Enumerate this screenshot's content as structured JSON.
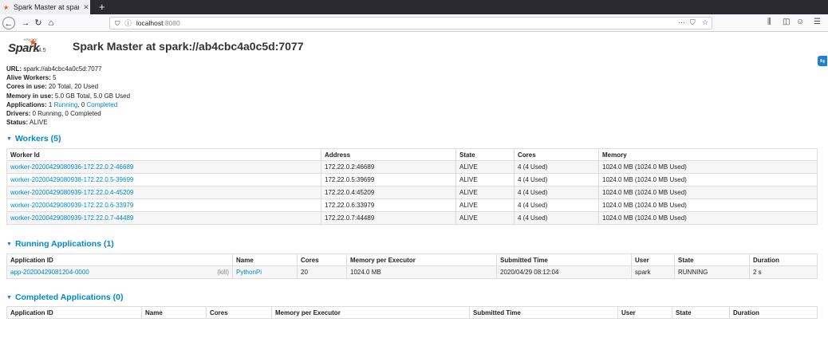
{
  "browser": {
    "tab_title": "Spark Master at spark://",
    "url_host": "localhost",
    "url_port": ":8080"
  },
  "header": {
    "logo_apache": "APACHE",
    "logo_text": "Spark",
    "version": "2.4.5",
    "title": "Spark Master at spark://ab4cbc4a0c5d:7077"
  },
  "summary": {
    "url_label": "URL:",
    "url_value": " spark://ab4cbc4a0c5d:7077",
    "alive_label": "Alive Workers:",
    "alive_value": " 5",
    "cores_label": "Cores in use:",
    "cores_value": " 20 Total, 20 Used",
    "memory_label": "Memory in use:",
    "memory_value": " 5.0 GB Total, 5.0 GB Used",
    "apps_label": "Applications:",
    "apps_running_count": " 1 ",
    "apps_running_link": "Running",
    "apps_sep": ", 0 ",
    "apps_completed_link": "Completed",
    "drivers_label": "Drivers:",
    "drivers_value": " 0 Running, 0 Completed",
    "status_label": "Status:",
    "status_value": " ALIVE"
  },
  "workers": {
    "heading": "Workers (5)",
    "columns": [
      "Worker Id",
      "Address",
      "State",
      "Cores",
      "Memory"
    ],
    "rows": [
      [
        "worker-20200429080936-172.22.0.2-46689",
        "172.22.0.2:46689",
        "ALIVE",
        "4 (4 Used)",
        "1024.0 MB (1024.0 MB Used)"
      ],
      [
        "worker-20200429080938-172.22.0.5-39699",
        "172.22.0.5:39699",
        "ALIVE",
        "4 (4 Used)",
        "1024.0 MB (1024.0 MB Used)"
      ],
      [
        "worker-20200429080939-172.22.0.4-45209",
        "172.22.0.4:45209",
        "ALIVE",
        "4 (4 Used)",
        "1024.0 MB (1024.0 MB Used)"
      ],
      [
        "worker-20200429080939-172.22.0.6-33979",
        "172.22.0.6:33979",
        "ALIVE",
        "4 (4 Used)",
        "1024.0 MB (1024.0 MB Used)"
      ],
      [
        "worker-20200429080939-172.22.0.7-44489",
        "172.22.0.7:44489",
        "ALIVE",
        "4 (4 Used)",
        "1024.0 MB (1024.0 MB Used)"
      ]
    ]
  },
  "running": {
    "heading": "Running Applications (1)",
    "columns": [
      "Application ID",
      "Name",
      "Cores",
      "Memory per Executor",
      "Submitted Time",
      "User",
      "State",
      "Duration"
    ],
    "rows": [
      {
        "id": "app-20200429081204-0000",
        "kill": "(kill)",
        "name": "PythonPi",
        "cores": "20",
        "memory": "1024.0 MB",
        "submitted": "2020/04/29 08:12:04",
        "user": "spark",
        "state": "RUNNING",
        "duration": "2 s"
      }
    ]
  },
  "completed": {
    "heading": "Completed Applications (0)",
    "columns": [
      "Application ID",
      "Name",
      "Cores",
      "Memory per Executor",
      "Submitted Time",
      "User",
      "State",
      "Duration"
    ]
  }
}
